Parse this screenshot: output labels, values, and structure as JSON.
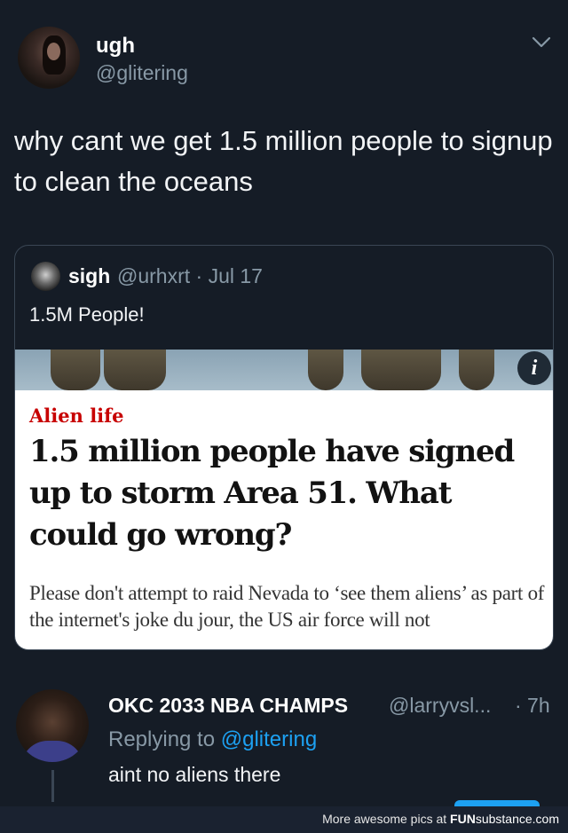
{
  "tweet": {
    "display_name": "ugh",
    "handle": "@glitering",
    "text": "why cant we get 1.5 million people to signup to clean the oceans"
  },
  "quote": {
    "display_name": "sigh",
    "handle_date": "@urhxrt · Jul 17",
    "text": "1.5M People!",
    "article": {
      "info_icon_label": "i",
      "kicker": "Alien life",
      "headline": "1.5 million people have signed up to storm Area 51. What could go wrong?",
      "standfirst": "Please don't attempt to raid Nevada to ‘see them aliens’ as part of the internet's joke du jour, the US air force will not"
    }
  },
  "reply": {
    "display_name": "OKC 2033 NBA CHAMPS",
    "handle": "@larryvsl...",
    "time": "· 7h",
    "replying_prefix": "Replying to",
    "replying_to": "@glitering",
    "text": "aint no aliens there"
  },
  "footer": {
    "text": "More awesome pics at",
    "brand_bold": "FUN",
    "brand_thin": "substance",
    "brand_tld": ".com"
  },
  "colors": {
    "background": "#151c26",
    "secondary_text": "#8899a6",
    "link": "#1da1f2",
    "kicker_red": "#c70000"
  }
}
